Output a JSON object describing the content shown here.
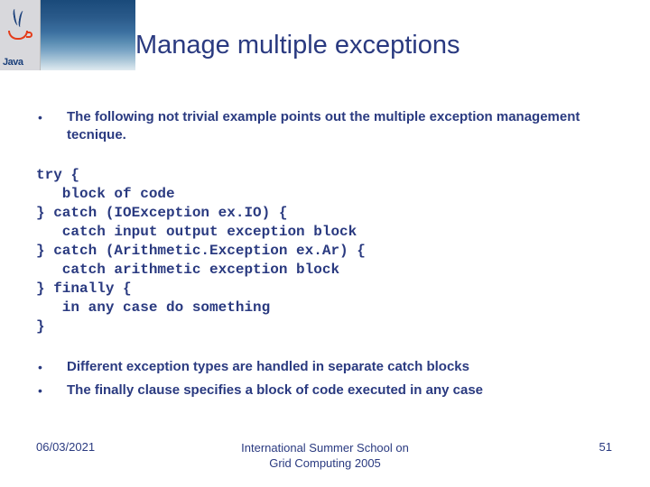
{
  "logo": {
    "text": "Java"
  },
  "title": "Manage multiple exceptions",
  "bullets_top": [
    "The following not trivial example points out the multiple exception management tecnique."
  ],
  "code": "try {\n   block of code\n} catch (IOException ex.IO) {\n   catch input output exception block\n} catch (Arithmetic.Exception ex.Ar) {\n   catch arithmetic exception block\n} finally {\n   in any case do something\n}",
  "bullets_bottom": [
    "Different exception types are handled in separate catch blocks",
    "The finally clause specifies a block of code executed in any case"
  ],
  "footer": {
    "date": "06/03/2021",
    "venue_line1": "International Summer School on",
    "venue_line2": "Grid Computing 2005",
    "page": "51"
  }
}
